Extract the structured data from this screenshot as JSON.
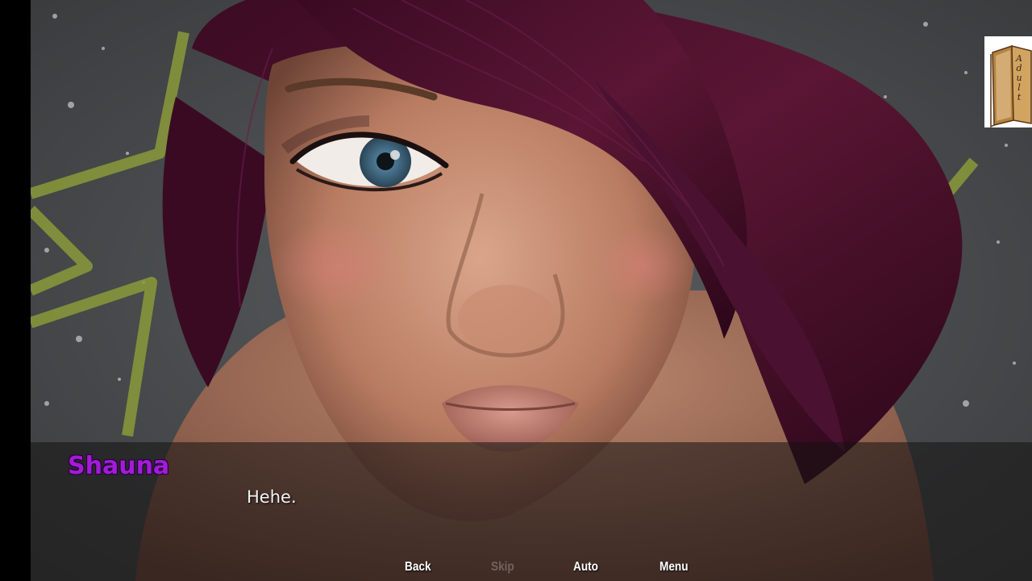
{
  "dialogue": {
    "speaker": "Shauna",
    "text": "Hehe.",
    "speaker_color": "#a21cd6"
  },
  "quick_menu": {
    "back": "Back",
    "skip": "Skip",
    "auto": "Auto",
    "menu": "Menu"
  },
  "badge": {
    "icon": "book-icon",
    "letters": [
      "A",
      "d",
      "u",
      "l",
      "t"
    ]
  },
  "colors": {
    "hair": "#4a0f2a",
    "background": "#4a4d4f",
    "star": "#8a9a3a"
  }
}
